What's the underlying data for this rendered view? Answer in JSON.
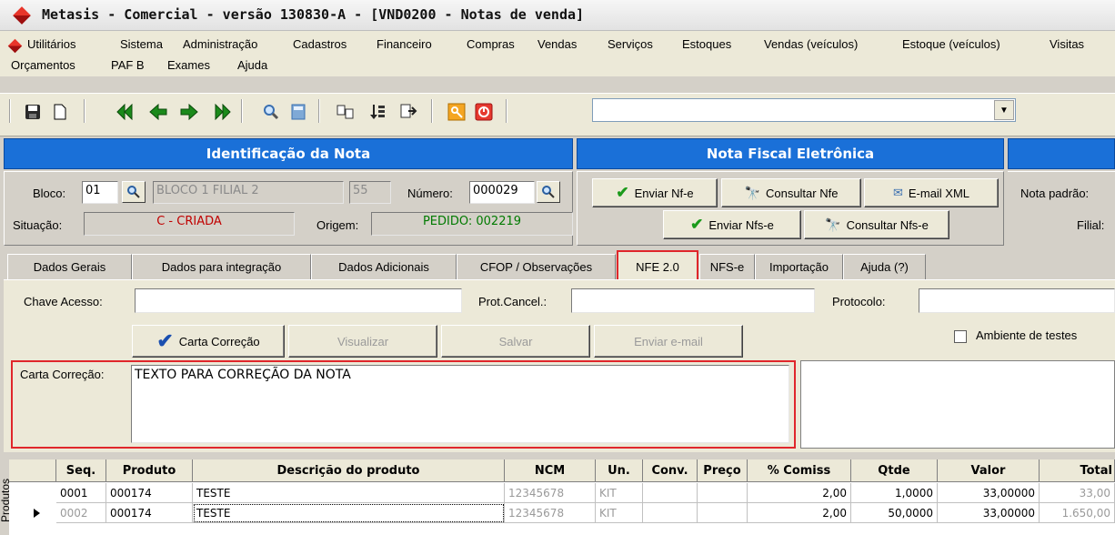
{
  "window": {
    "title": "Metasis - Comercial - versão 130830-A - [VND0200 - Notas de venda]"
  },
  "menu": {
    "row1": [
      "Utilitários",
      "Sistema",
      "Administração",
      "Cadastros",
      "Financeiro",
      "Compras",
      "Vendas",
      "Serviços",
      "Estoques",
      "Vendas (veículos)",
      "Estoque (veículos)",
      "Visitas"
    ],
    "row2": [
      "Orçamentos",
      "PAF B",
      "Exames",
      "Ajuda"
    ]
  },
  "toolbar": {
    "icons": [
      "save-icon",
      "new-document-icon",
      "first-record-icon",
      "previous-record-icon",
      "next-record-icon",
      "last-record-icon",
      "search-icon",
      "calculator-icon",
      "copy-icon",
      "sort-icon",
      "export-icon",
      "key-icon",
      "stop-icon"
    ],
    "combo_value": ""
  },
  "identificacao": {
    "header": "Identificação da Nota",
    "bloco_label": "Bloco:",
    "bloco_value": "01",
    "bloco_desc": "BLOCO 1 FILIAL 2",
    "serie": "55",
    "numero_label": "Número:",
    "numero_value": "000029",
    "situacao_label": "Situação:",
    "situacao_value": "C - CRIADA",
    "origem_label": "Origem:",
    "origem_value": "PEDIDO: 002219"
  },
  "nfe": {
    "header": "Nota Fiscal Eletrônica",
    "enviar_nfe": "Enviar Nf-e",
    "consultar_nfe": "Consultar Nfe",
    "email_xml": "E-mail XML",
    "enviar_nfse": "Enviar Nfs-e",
    "consultar_nfse": "Consultar Nfs-e"
  },
  "right_panel": {
    "nota_padrao_label": "Nota padrão:",
    "filial_label": "Filial:"
  },
  "tabs": [
    {
      "label": "Dados Gerais"
    },
    {
      "label": "Dados para integração"
    },
    {
      "label": "Dados Adicionais"
    },
    {
      "label": "CFOP / Observações"
    },
    {
      "label": "NFE 2.0"
    },
    {
      "label": "NFS-e"
    },
    {
      "label": "Importação"
    },
    {
      "label": "Ajuda (?)"
    }
  ],
  "nfe_tab": {
    "chave_label": "Chave Acesso:",
    "chave_value": "",
    "prot_cancel_label": "Prot.Cancel.:",
    "prot_cancel_value": "",
    "protocolo_label": "Protocolo:",
    "protocolo_value": "",
    "carta_correcao_btn": "Carta Correção",
    "visualizar_btn": "Visualizar",
    "salvar_btn": "Salvar",
    "enviar_email_btn": "Enviar e-mail",
    "ambiente_testes_label": "Ambiente de testes",
    "ambiente_testes_checked": false,
    "carta_correcao_label": "Carta Correção:",
    "carta_correcao_text": "TEXTO PARA CORREÇÃO DA NOTA"
  },
  "grid": {
    "side_label": "Produtos",
    "columns": [
      "Seq.",
      "Produto",
      "Descrição do produto",
      "NCM",
      "Un.",
      "Conv.",
      "Preço",
      "% Comiss",
      "Qtde",
      "Valor",
      "Total"
    ],
    "rows": [
      [
        "0001",
        "000174",
        "TESTE",
        "12345678",
        "KIT",
        "",
        "",
        "2,00",
        "1,0000",
        "33,00000",
        "33,00"
      ],
      [
        "0002",
        "000174",
        "TESTE",
        "12345678",
        "KIT",
        "",
        "",
        "2,00",
        "50,0000",
        "33,00000",
        "1.650,00"
      ]
    ]
  }
}
